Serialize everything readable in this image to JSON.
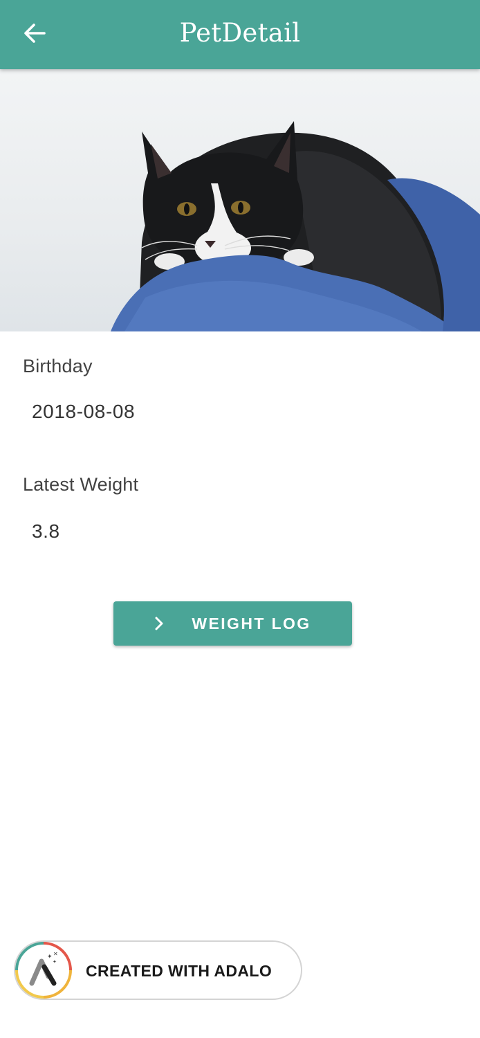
{
  "header": {
    "title": "PetDetail",
    "back_icon": "arrow-left-icon",
    "background_color": "#4aa597"
  },
  "hero": {
    "subject": "pet-photo"
  },
  "fields": {
    "birthday_label": "Birthday",
    "birthday_value": "2018-08-08",
    "weight_label": "Latest Weight",
    "weight_value": "3.8"
  },
  "actions": {
    "weight_log_label": "WEIGHT LOG",
    "weight_log_icon": "chevron-right-icon"
  },
  "badge": {
    "label": "CREATED WITH ADALO",
    "logo_icon": "adalo-logo-icon"
  },
  "colors": {
    "accent": "#4aa597",
    "text": "#333333"
  }
}
